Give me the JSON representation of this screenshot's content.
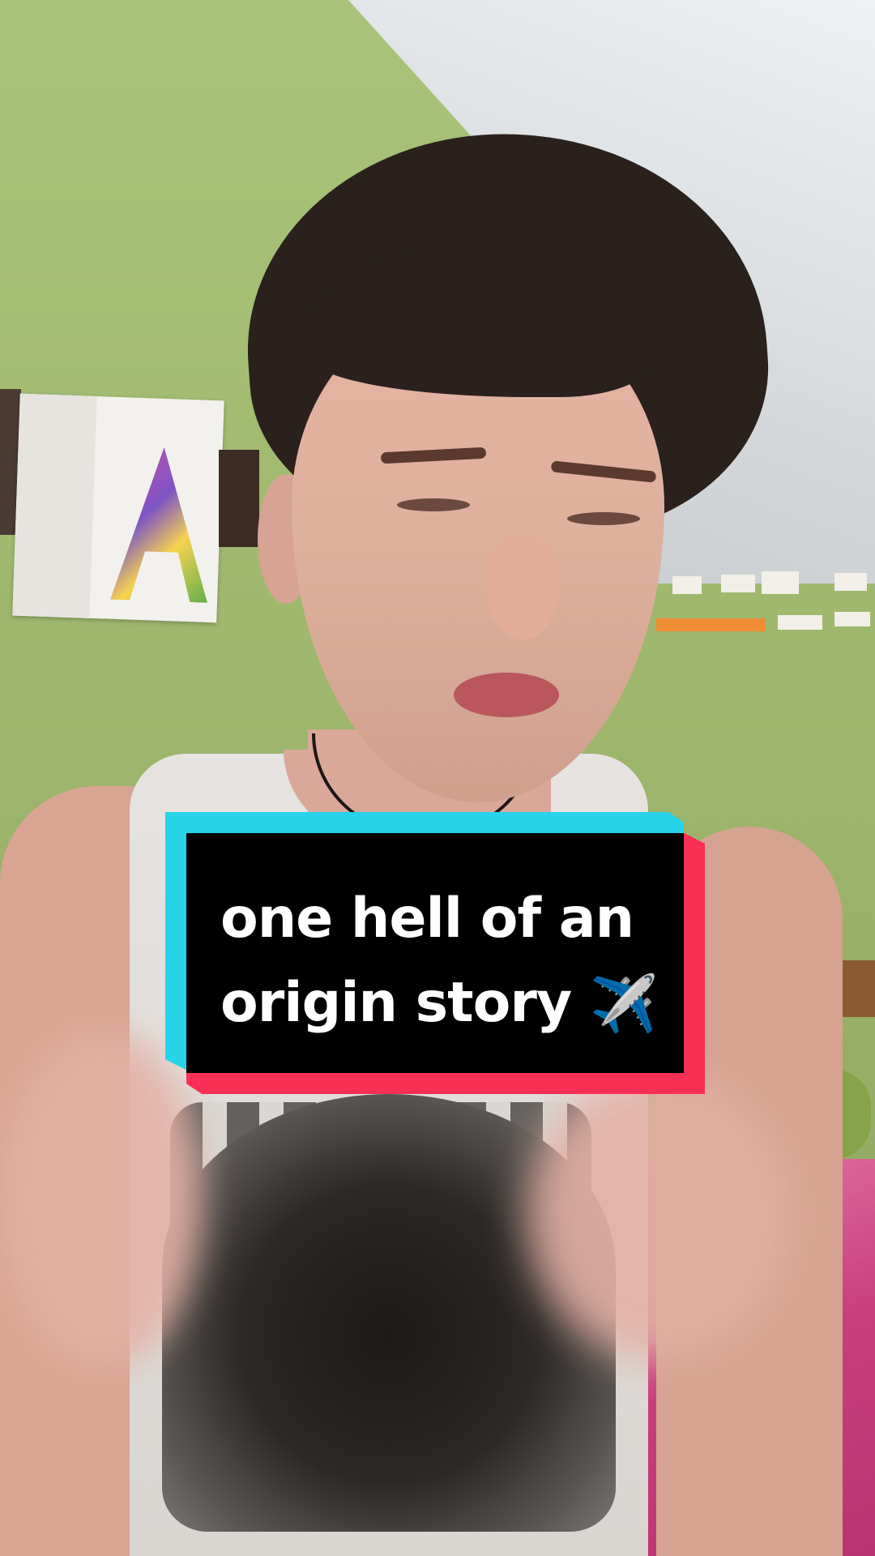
{
  "caption": {
    "line1": "one hell of an",
    "line2": "origin story",
    "emoji": "✈️"
  },
  "colors": {
    "caption_background": "#000000",
    "caption_text": "#ffffff",
    "accent_cyan": "#26d3e8",
    "accent_red": "#fa2f55"
  }
}
